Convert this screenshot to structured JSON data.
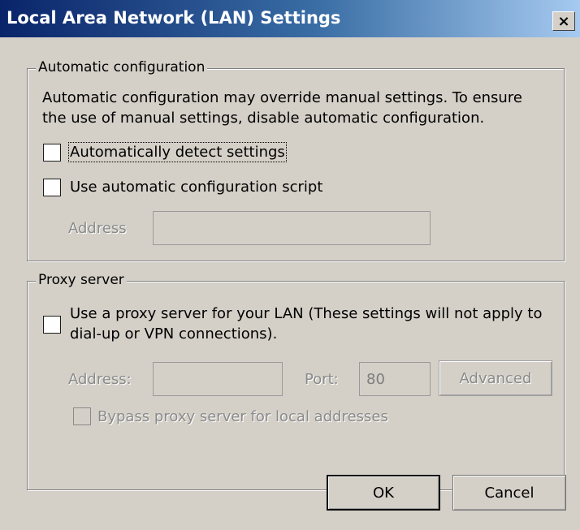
{
  "window": {
    "title": "Local Area Network (LAN) Settings",
    "close_label": "×"
  },
  "auto_config": {
    "group_label": "Automatic configuration",
    "description_line1": "Automatic configuration may override manual settings.  To ensure",
    "description_line2": "the use of manual settings, disable automatic configuration.",
    "detect_settings": {
      "label": "Automatically detect settings",
      "checked": false
    },
    "use_script": {
      "label": "Use automatic configuration script",
      "checked": false
    },
    "address": {
      "label": "Address",
      "value": ""
    }
  },
  "proxy": {
    "group_label": "Proxy server",
    "use_proxy": {
      "label_line1": "Use a proxy server for your LAN (These settings will not apply to",
      "label_line2": "dial-up or VPN connections).",
      "checked": false
    },
    "address": {
      "label": "Address:",
      "value": ""
    },
    "port": {
      "label": "Port:",
      "value": "80"
    },
    "advanced_label": "Advanced",
    "bypass_local": {
      "label": "Bypass proxy server for local addresses",
      "checked": false
    }
  },
  "buttons": {
    "ok_label": "OK",
    "cancel_label": "Cancel"
  },
  "colors": {
    "titlebar_start": "#0a246a",
    "titlebar_end": "#a6caf0",
    "dialog_face": "#d4d0c8",
    "disabled_text": "#8a8a8a"
  }
}
